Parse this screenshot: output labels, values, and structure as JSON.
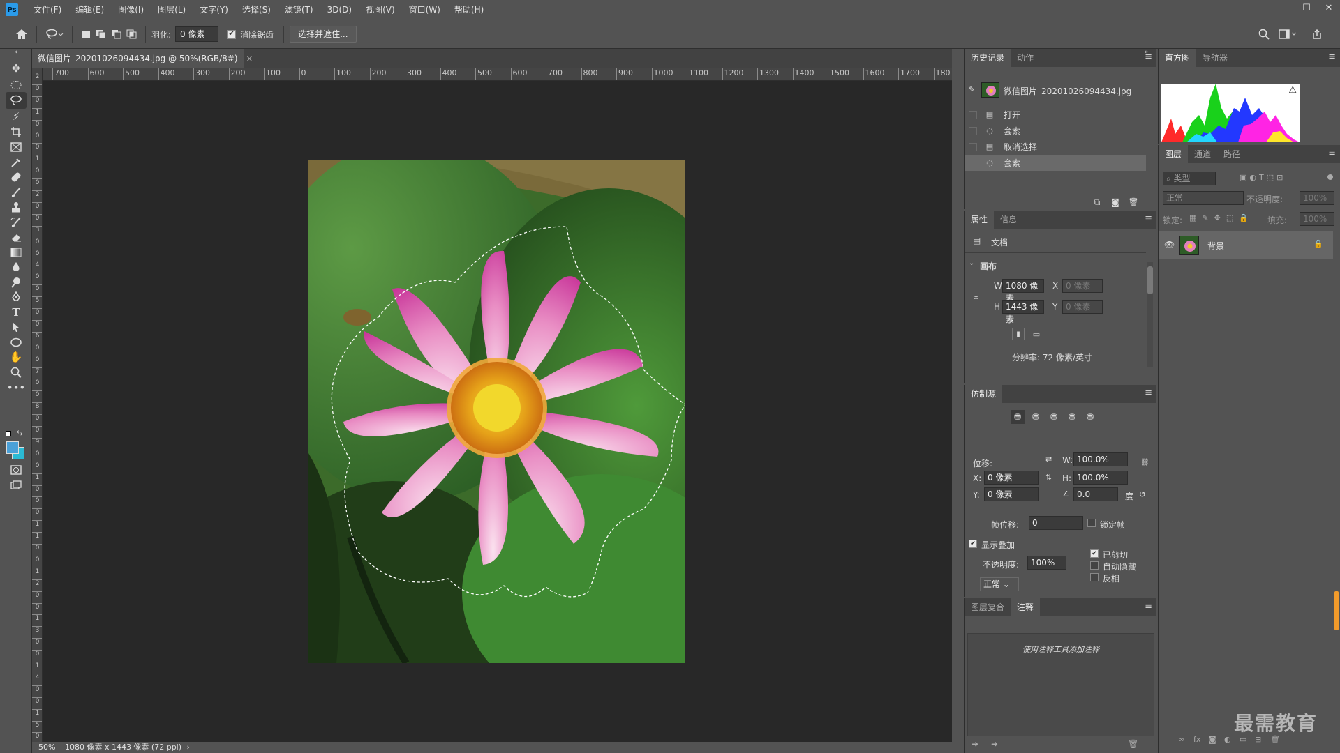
{
  "app": {
    "logo": "Ps",
    "brand_color": "#2b9bea"
  },
  "menu": [
    "文件(F)",
    "编辑(E)",
    "图像(I)",
    "图层(L)",
    "文字(Y)",
    "选择(S)",
    "滤镜(T)",
    "3D(D)",
    "视图(V)",
    "窗口(W)",
    "帮助(H)"
  ],
  "window_controls": {
    "minimize": "—",
    "maximize": "☐",
    "close": "✕"
  },
  "options": {
    "feather_label": "羽化:",
    "feather_value": "0 像素",
    "antialias_label": "消除锯齿",
    "antialias_checked": true,
    "select_mask_button": "选择并遮住..."
  },
  "document": {
    "tab_title": "微信图片_20201026094434.jpg @ 50%(RGB/8#)",
    "tab_close": "×",
    "ruler_h": [
      "700",
      "600",
      "500",
      "400",
      "300",
      "200",
      "100",
      "0",
      "100",
      "200",
      "300",
      "400",
      "500",
      "600",
      "700",
      "800",
      "900",
      "1000",
      "1100",
      "1200",
      "1300",
      "1400",
      "1500",
      "1600",
      "1700",
      "180"
    ],
    "ruler_v": [
      "2",
      "0",
      "0",
      "1",
      "0",
      "0",
      "0",
      "1",
      "0",
      "0",
      "2",
      "0",
      "0",
      "3",
      "0",
      "0",
      "4",
      "0",
      "0",
      "5",
      "0",
      "0",
      "6",
      "0",
      "0",
      "7",
      "0",
      "0",
      "8",
      "0",
      "0",
      "9",
      "0",
      "0",
      "1",
      "0",
      "0",
      "0",
      "1",
      "1",
      "0",
      "0",
      "1",
      "2",
      "0",
      "0",
      "1",
      "3",
      "0",
      "0",
      "1",
      "4",
      "0",
      "0",
      "1",
      "5",
      "0"
    ]
  },
  "status": {
    "zoom": "50%",
    "info": "1080 像素 x 1443 像素 (72 ppi)",
    "arrow": "›"
  },
  "history_panel": {
    "tabs": [
      "历史记录",
      "动作"
    ],
    "snapshot": "微信图片_20201026094434.jpg",
    "items": [
      {
        "label": "打开",
        "icon": "document-icon"
      },
      {
        "label": "套索",
        "icon": "lasso-icon"
      },
      {
        "label": "取消选择",
        "icon": "document-icon"
      },
      {
        "label": "套索",
        "icon": "lasso-icon"
      }
    ]
  },
  "properties_panel": {
    "tabs": [
      "属性",
      "信息"
    ],
    "doc_label": "文档",
    "canvas_label": "画布",
    "w_label": "W",
    "w_value": "1080 像素",
    "h_label": "H",
    "h_value": "1443 像素",
    "x_label": "X",
    "x_value": "0 像素",
    "y_label": "Y",
    "y_value": "0 像素",
    "resolution": "分辨率: 72 像素/英寸"
  },
  "clone_panel": {
    "title": "仿制源",
    "offset_label": "位移:",
    "w_label": "W:",
    "w_value": "100.0%",
    "h_label": "H:",
    "h_value": "100.0%",
    "x_label": "X:",
    "x_value": "0 像素",
    "y_label": "Y:",
    "y_value": "0 像素",
    "angle_value": "0.0",
    "angle_unit": "度",
    "frame_offset_label": "帧位移:",
    "frame_offset_value": "0",
    "lock_frame": "锁定帧",
    "show_overlay": "显示叠加",
    "opacity_label": "不透明度:",
    "opacity_value": "100%",
    "clipped": "已剪切",
    "auto_hide": "自动隐藏",
    "invert": "反相",
    "blend_mode": "正常"
  },
  "notes_panel": {
    "tabs": [
      "图层复合",
      "注释"
    ],
    "hint": "使用注释工具添加注释"
  },
  "histogram_panel": {
    "tabs": [
      "直方图",
      "导航器"
    ],
    "warning": "⚠"
  },
  "layers_panel": {
    "tabs": [
      "图层",
      "通道",
      "路径"
    ],
    "filter_placeholder": "类型",
    "blend_mode": "正常",
    "opacity_label": "不透明度:",
    "opacity_value": "100%",
    "lock_label": "锁定:",
    "fill_label": "填充:",
    "fill_value": "100%",
    "layers": [
      {
        "name": "背景",
        "visible": true,
        "locked": true
      }
    ]
  },
  "watermark": "最需教育"
}
